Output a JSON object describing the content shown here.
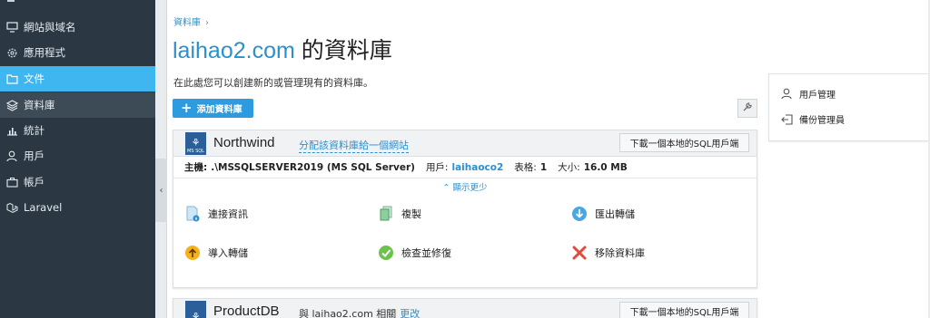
{
  "sidebar": {
    "items": [
      {
        "label": "網站與域名",
        "icon": "monitor-icon"
      },
      {
        "label": "應用程式",
        "icon": "gear-icon"
      },
      {
        "label": "文件",
        "icon": "folder-icon"
      },
      {
        "label": "資料庫",
        "icon": "database-icon"
      },
      {
        "label": "統計",
        "icon": "bar-chart-icon"
      },
      {
        "label": "用戶",
        "icon": "user-icon"
      },
      {
        "label": "帳戶",
        "icon": "briefcase-icon"
      },
      {
        "label": "Laravel",
        "icon": "laravel-icon"
      }
    ],
    "active_color": "#40b6f1",
    "bg_color": "#2b3742"
  },
  "breadcrumb": {
    "item": "資料庫",
    "sep": "›"
  },
  "page": {
    "title_domain": "laihao2.com",
    "title_suffix": " 的資料庫",
    "intro": "在此處您可以創建新的或管理現有的資料庫。",
    "add_button": "添加資料庫"
  },
  "databases": [
    {
      "logo_text": "MS SQL",
      "name": "Northwind",
      "link": "分配該資料庫給一個網站",
      "download": "下載一個本地的SQL用戶端",
      "host_label": "主機:",
      "host_value": ".\\MSSQLSERVER2019 (MS SQL Server)",
      "user_label": "用戶:",
      "user_value": "laihaoco2",
      "tables_label": "表格:",
      "tables_value": "1",
      "size_label": "大小:",
      "size_value": "16.0 MB",
      "show_less": "⌃ 顯示更少",
      "actions": [
        {
          "label": "連接資訊",
          "icon": "connection-info-icon"
        },
        {
          "label": "複製",
          "icon": "copy-icon"
        },
        {
          "label": "匯出轉儲",
          "icon": "export-dump-icon"
        },
        {
          "label": "導入轉儲",
          "icon": "import-dump-icon"
        },
        {
          "label": "檢查並修復",
          "icon": "check-repair-icon"
        },
        {
          "label": "移除資料庫",
          "icon": "remove-database-icon"
        }
      ]
    },
    {
      "name": "ProductDB",
      "related_prefix": "與 laihao2.com 相關",
      "edit": "更改",
      "download": "下載一個本地的SQL用戶端"
    }
  ],
  "right_panel": {
    "items": [
      {
        "label": "用戶管理",
        "icon": "user-manage-icon"
      },
      {
        "label": "備份管理員",
        "icon": "backup-icon"
      }
    ]
  }
}
